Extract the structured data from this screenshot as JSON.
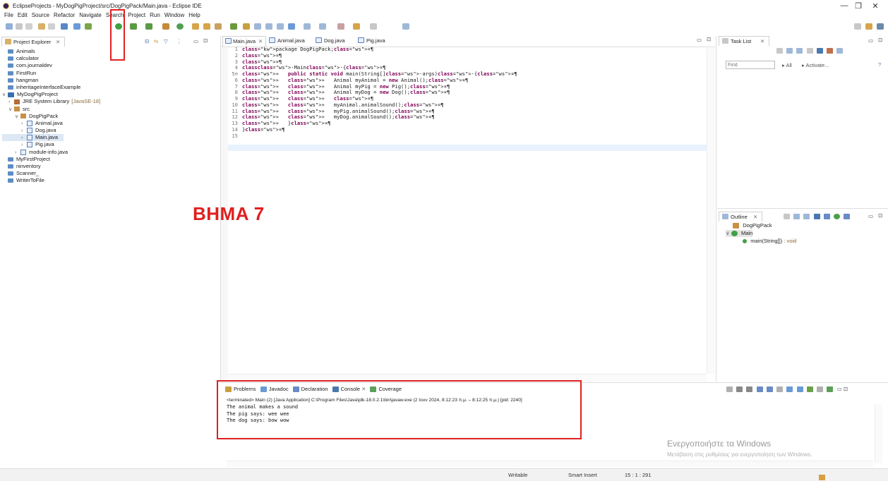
{
  "window": {
    "title": "EclipseProjects - MyDogPigProject/src/DogPigPack/Main.java - Eclipse IDE",
    "minimize": "—",
    "maximize": "❐",
    "close": "✕"
  },
  "menu": [
    "File",
    "Edit",
    "Source",
    "Refactor",
    "Navigate",
    "Search",
    "Project",
    "Run",
    "Window",
    "Help"
  ],
  "project_explorer": {
    "tab_label": "Project Explorer",
    "items": [
      {
        "label": "Animals",
        "indent": 0,
        "type": "project",
        "chev": ""
      },
      {
        "label": "calculator",
        "indent": 0,
        "type": "project",
        "chev": ""
      },
      {
        "label": "com.journaldev",
        "indent": 0,
        "type": "project",
        "chev": ""
      },
      {
        "label": "FirstRun",
        "indent": 0,
        "type": "project",
        "chev": ""
      },
      {
        "label": "hangman",
        "indent": 0,
        "type": "project",
        "chev": ""
      },
      {
        "label": "inheritageInterfaceExample",
        "indent": 0,
        "type": "project",
        "chev": ""
      },
      {
        "label": "MyDogPigProject",
        "indent": 0,
        "type": "javaproject",
        "chev": "v"
      },
      {
        "label": "JRE System Library",
        "extra": "[JavaSE-18]",
        "indent": 1,
        "type": "lib",
        "chev": ">"
      },
      {
        "label": "src",
        "indent": 1,
        "type": "pkg",
        "chev": "v"
      },
      {
        "label": "DogPigPack",
        "indent": 2,
        "type": "pkg",
        "chev": "v"
      },
      {
        "label": "Animal.java",
        "indent": 3,
        "type": "java",
        "chev": ">"
      },
      {
        "label": "Dog.java",
        "indent": 3,
        "type": "java",
        "chev": ">"
      },
      {
        "label": "Main.java",
        "indent": 3,
        "type": "java",
        "chev": ">",
        "selected": true
      },
      {
        "label": "Pig.java",
        "indent": 3,
        "type": "java",
        "chev": ">"
      },
      {
        "label": "module-info.java",
        "indent": 2,
        "type": "java",
        "chev": ">"
      },
      {
        "label": "MyFirstProject",
        "indent": 0,
        "type": "project",
        "chev": ""
      },
      {
        "label": "ninventory",
        "indent": 0,
        "type": "project",
        "chev": ""
      },
      {
        "label": "Scanner_",
        "indent": 0,
        "type": "project",
        "chev": ""
      },
      {
        "label": "WriterToFile",
        "indent": 0,
        "type": "project",
        "chev": ""
      }
    ]
  },
  "editor": {
    "tabs": [
      {
        "label": "Main.java",
        "active": true
      },
      {
        "label": "Animal.java",
        "active": false
      },
      {
        "label": "Dog.java",
        "active": false
      },
      {
        "label": "Pig.java",
        "active": false
      }
    ],
    "lines": [
      {
        "n": "1",
        "text": "package DogPigPack;¤¶"
      },
      {
        "n": "2",
        "text": "¤¶"
      },
      {
        "n": "3",
        "text": "¤¶"
      },
      {
        "n": "4",
        "text": "class·Main·{¤¶"
      },
      {
        "n": "5⊖",
        "text": "»   public static void main(String[]·args)·{¤¶"
      },
      {
        "n": "6",
        "text": "»   »   Animal myAnimal = new Animal();¤¶"
      },
      {
        "n": "7",
        "text": "»   »   Animal myPig = new Pig();¤¶"
      },
      {
        "n": "8",
        "text": "»   »   Animal myDog = new Dog();¤¶"
      },
      {
        "n": "9",
        "text": "»   »   ¤¶"
      },
      {
        "n": "10",
        "text": "»   »   myAnimal.animalSound();¤¶"
      },
      {
        "n": "11",
        "text": "»   »   myPig.animalSound();¤¶"
      },
      {
        "n": "12",
        "text": "»   »   myDog.animalSound();¤¶"
      },
      {
        "n": "13",
        "text": "»   }¤¶"
      },
      {
        "n": "14",
        "text": "}¤¶"
      },
      {
        "n": "15",
        "text": ""
      }
    ]
  },
  "annotation": "BHMA 7",
  "task_list": {
    "tab_label": "Task List",
    "find_placeholder": "Find",
    "all_label": "All",
    "activate_label": "Activate..."
  },
  "outline": {
    "tab_label": "Outline",
    "package": "DogPigPack",
    "class": "Main",
    "method": "main(String[])",
    "method_type": ": void"
  },
  "bottom_panel": {
    "tabs": [
      "Problems",
      "Javadoc",
      "Declaration",
      "Console",
      "Coverage"
    ],
    "terminated": "<terminated> Main (2) [Java Application] C:\\Program Files\\Java\\jdk-18.0.2.1\\bin\\javaw.exe (2 Ιουν 2024, 8:12:23 π.μ. – 8:12:25 π.μ.) [pid: 2240]",
    "output": [
      "The animal makes a sound",
      "The pig says: wee wee",
      "The dog says: bow wow"
    ]
  },
  "watermark": {
    "line1": "Ενεργοποιήστε τα Windows",
    "line2": "Μετάβαση στις ρυθμίσεις για ενεργοποίηση των Windows."
  },
  "status": {
    "writable": "Writable",
    "insert_mode": "Smart Insert",
    "position": "15 : 1 : 291"
  },
  "colors": {
    "marker": "#e02020",
    "keyword": "#7f0055",
    "current_line": "#e8f2fe"
  }
}
